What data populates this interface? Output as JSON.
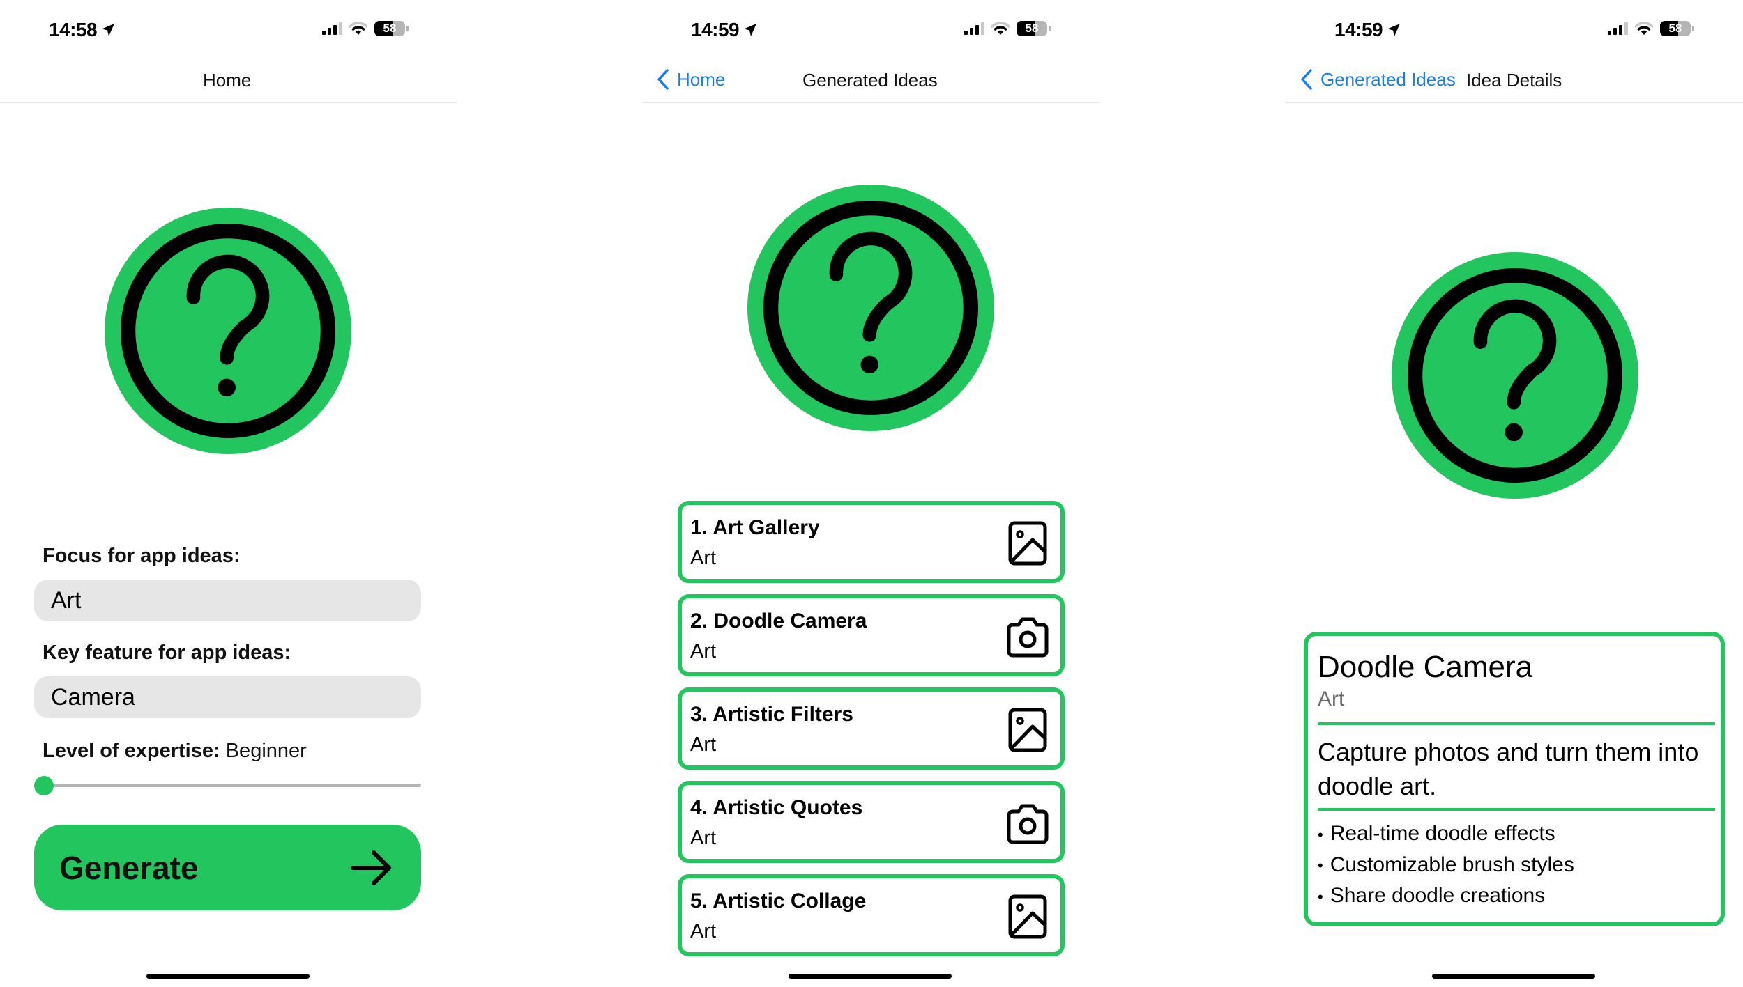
{
  "colors": {
    "accent": "#22c55e",
    "link": "#1a7cf5",
    "input_bg": "#e6e6e6"
  },
  "screens": {
    "home": {
      "status": {
        "time": "14:58",
        "battery": "58",
        "battery_level": 0.58
      },
      "nav": {
        "title": "Home"
      },
      "hero_icon": "question-circle-icon",
      "form": {
        "focus_label": "Focus for app ideas:",
        "focus_value": "Art",
        "feature_label": "Key feature for app ideas:",
        "feature_value": "Camera",
        "level_label": "Level of expertise:",
        "level_value": "Beginner",
        "level_slider_fraction": 0.0
      },
      "generate_button": {
        "label": "Generate",
        "icon": "arrow-right-icon"
      }
    },
    "ideas": {
      "status": {
        "time": "14:59",
        "battery": "58",
        "battery_level": 0.58
      },
      "nav": {
        "back_label": "Home",
        "title": "Generated Ideas"
      },
      "hero_icon": "question-circle-icon",
      "items": [
        {
          "title": "1. Art Gallery",
          "category": "Art",
          "icon": "photo-icon"
        },
        {
          "title": "2. Doodle Camera",
          "category": "Art",
          "icon": "camera-icon"
        },
        {
          "title": "3. Artistic Filters",
          "category": "Art",
          "icon": "photo-icon"
        },
        {
          "title": "4. Artistic Quotes",
          "category": "Art",
          "icon": "camera-icon"
        },
        {
          "title": "5. Artistic Collage",
          "category": "Art",
          "icon": "photo-icon"
        }
      ]
    },
    "details": {
      "status": {
        "time": "14:59",
        "battery": "58",
        "battery_level": 0.58
      },
      "nav": {
        "back_label": "Generated Ideas",
        "title": "Idea Details"
      },
      "hero_icon": "question-circle-icon",
      "idea": {
        "title": "Doodle Camera",
        "category": "Art",
        "description": "Capture photos and turn them into doodle art.",
        "features": [
          "Real-time doodle effects",
          "Customizable brush styles",
          "Share doodle creations"
        ]
      }
    }
  }
}
